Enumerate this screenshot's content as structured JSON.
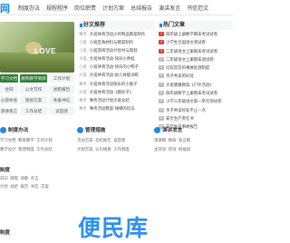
{
  "logo": "网",
  "nav": [
    "制度办法",
    "规程程序",
    "岗位职责",
    "计划方案",
    "总结报告",
    "演讲发言",
    "书信范文"
  ],
  "hero_image_text": "LOVE",
  "categories": [
    "学习文档",
    "教育教学资源",
    "工作计划",
    "合同",
    "公文写作",
    "述职报告",
    "心得体会",
    "策划方案",
    "条据书信",
    "演讲发言",
    "工作总结",
    "读后感"
  ],
  "middle": {
    "title": "好文推荐",
    "items": [
      {
        "tag": "事务",
        "text": "大班体育活动小鸡鸭品教案制作"
      },
      {
        "tag": "小班",
        "text": "小班区角材料与教案制作"
      },
      {
        "tag": "小班",
        "text": "小班游戏活动计划书与策划"
      },
      {
        "tag": "大班",
        "text": "大班体育活动-快乐小青蛙"
      },
      {
        "tag": "小班",
        "text": "小班体育活动-快乐的小鸭子"
      },
      {
        "tag": "大班",
        "text": "大班体育活动-幼儿体能训练"
      },
      {
        "tag": "事务",
        "text": "大班体育活动快乐的小猴子"
      },
      {
        "tag": "大班",
        "text": "大班体育活动《跳房子》"
      },
      {
        "tag": "事务",
        "text": "事务活动计划大班总结"
      },
      {
        "tag": "事务",
        "text": "事务活动教案-绳梯的玩法"
      }
    ]
  },
  "right": {
    "title": "热门文章",
    "items": [
      "四年级上册数学期末考试试卷",
      "小学生全国语文测试卷",
      "二年级语文上册期末考试试卷",
      "二年级语文上册期末测试卷",
      "比较常见的事故处理制度",
      "亲子共读的好处",
      "大班健康教案《户外活动》",
      "四年级数学上册期末考试试卷",
      "小学三年级语文第一单元测试卷",
      "亲子共读好处不止一点",
      "安全生产责任书",
      "安全生产事故报告"
    ]
  },
  "sections": [
    {
      "title": "制度办法",
      "links": [
        "学习文档",
        "教育教学",
        "工作计划",
        "教学设计",
        "管理制度",
        "工作总结"
      ]
    },
    {
      "title": "管理措施",
      "links": [
        "活动方案",
        "总结报告",
        "读后感",
        "计划方案",
        "公司规章",
        "工作制度"
      ]
    },
    {
      "title": "演讲发言",
      "links": [
        "演讲稿",
        "致辞",
        "发言稿",
        "主持词",
        "贺词",
        "祝福语"
      ]
    }
  ],
  "bottom": {
    "title1": "制度",
    "line1": [
      "日记",
      "随笔",
      "诗歌",
      "名言"
    ],
    "line2": [
      "计划",
      "总结",
      "报告",
      "书信",
      "方案"
    ],
    "title2": "制度"
  },
  "watermark": "便民库",
  "accent": "#1e88e5",
  "green": "#2e7d32"
}
